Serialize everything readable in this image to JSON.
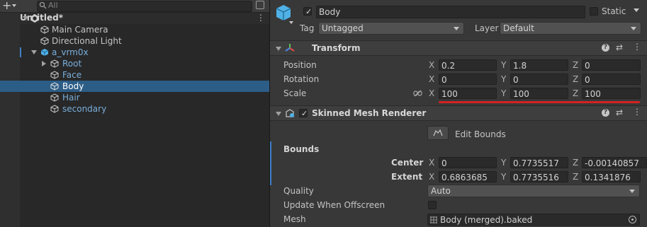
{
  "hierarchy": {
    "search_placeholder": "All",
    "scene_name": "Untitled*",
    "items": [
      {
        "label": "Main Camera"
      },
      {
        "label": "Directional Light"
      },
      {
        "label": "a_vrm0x"
      },
      {
        "label": "Root"
      },
      {
        "label": "Face"
      },
      {
        "label": "Body"
      },
      {
        "label": "Hair"
      },
      {
        "label": "secondary"
      }
    ]
  },
  "inspector": {
    "object_name": "Body",
    "static_label": "Static",
    "tag_label": "Tag",
    "tag_value": "Untagged",
    "layer_label": "Layer",
    "layer_value": "Default",
    "transform": {
      "title": "Transform",
      "position_label": "Position",
      "rotation_label": "Rotation",
      "scale_label": "Scale",
      "axes": [
        "X",
        "Y",
        "Z"
      ],
      "position": [
        "0.2",
        "1.8",
        "0"
      ],
      "rotation": [
        "0",
        "0",
        "0"
      ],
      "scale": [
        "100",
        "100",
        "100"
      ]
    },
    "smr": {
      "title": "Skinned Mesh Renderer",
      "edit_bounds": "Edit Bounds",
      "bounds_label": "Bounds",
      "center_label": "Center",
      "extent_label": "Extent",
      "center": [
        "0",
        "0.7735517",
        "-0.00140857"
      ],
      "extent": [
        "0.6863685",
        "0.7735516",
        "0.1341876"
      ],
      "quality_label": "Quality",
      "quality_value": "Auto",
      "update_offscreen_label": "Update When Offscreen",
      "mesh_label": "Mesh",
      "mesh_value": "Body (merged).baked"
    }
  },
  "colors": {
    "selection": "#2c5d87",
    "annotation_line": "#d42222",
    "cube_blue": "#4fb1e6"
  }
}
